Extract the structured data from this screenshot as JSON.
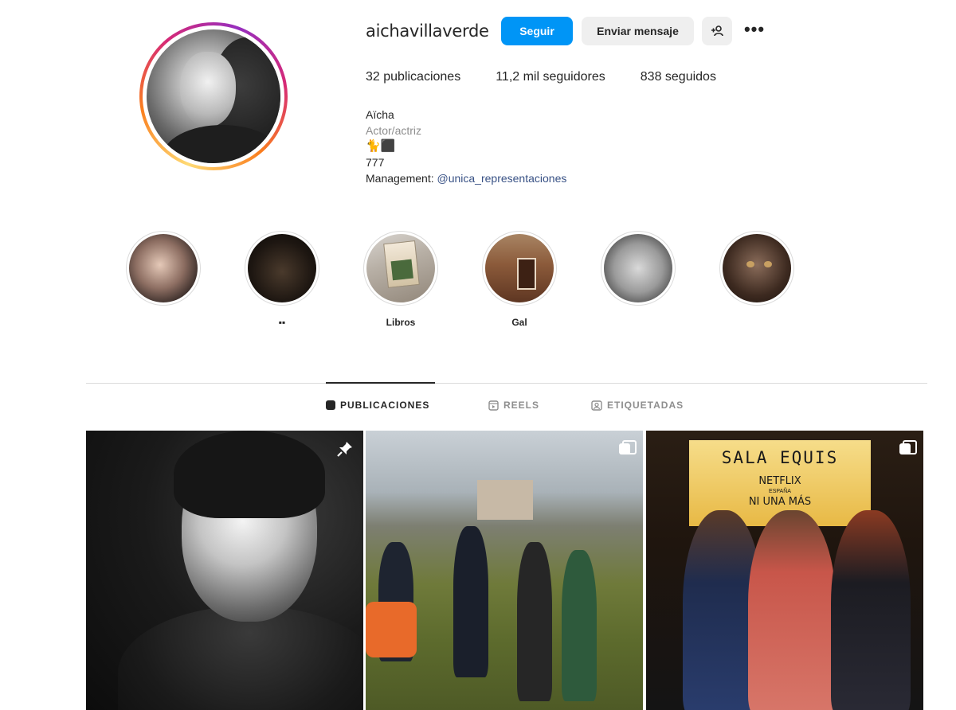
{
  "profile": {
    "username": "aichavillaverde",
    "follow_label": "Seguir",
    "message_label": "Enviar mensaje",
    "add_user_icon": "person-plus-icon",
    "more_icon": "•••",
    "stats": {
      "posts": "32 publicaciones",
      "followers": "11,2 mil seguidores",
      "following": "838 seguidos"
    },
    "bio": {
      "name": "Aïcha",
      "category": "Actor/actriz",
      "emoji_line": "🐈⬛",
      "number_line": "777",
      "management_prefix": "Management: ",
      "management_link": "@unica_representaciones"
    }
  },
  "highlights": [
    {
      "label": ""
    },
    {
      "label": "▪▪"
    },
    {
      "label": "Libros"
    },
    {
      "label": "Gal"
    },
    {
      "label": ""
    },
    {
      "label": ""
    }
  ],
  "tabs": {
    "posts": "PUBLICACIONES",
    "reels": "REELS",
    "tagged": "ETIQUETADAS"
  },
  "posts": [
    {
      "badge": "pin-icon"
    },
    {
      "badge": "carousel-icon"
    },
    {
      "badge": "carousel-icon",
      "sign": {
        "line1": "SALA EQUIS",
        "line2": "NETFLIX",
        "line3": "ESPAÑA",
        "line4": "NI UNA MÁS"
      }
    }
  ],
  "colors": {
    "primary_button": "#0095f6",
    "secondary_button": "#efefef",
    "link": "#385185",
    "muted": "#8e8e8e"
  }
}
